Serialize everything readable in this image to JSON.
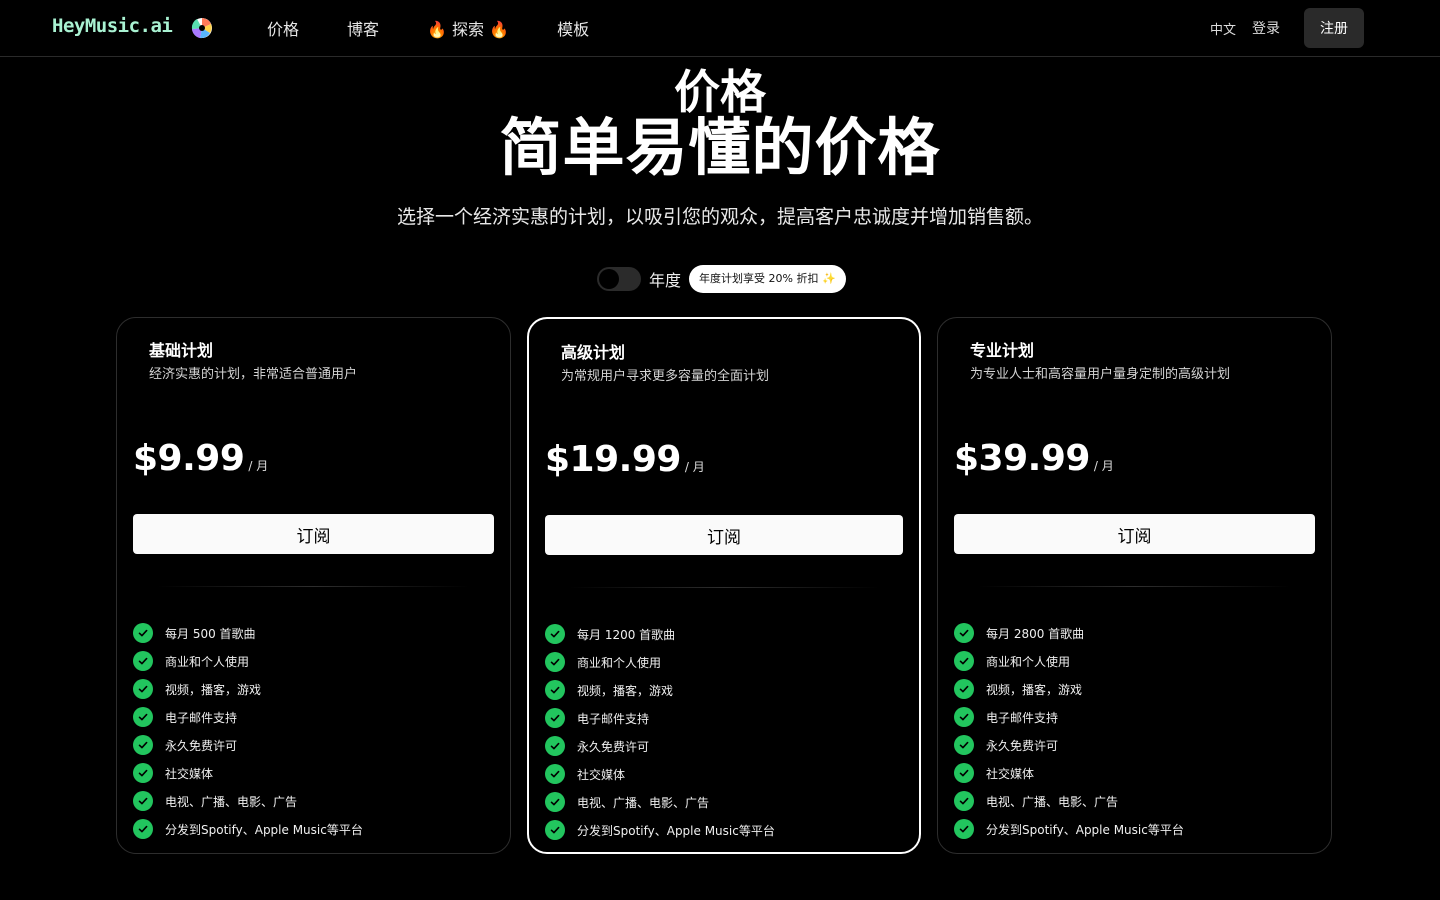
{
  "nav": {
    "logo": "HeyMusic.ai",
    "links": [
      "价格",
      "博客",
      "🔥 探索 🔥",
      "模板"
    ],
    "language": "中文",
    "login": "登录",
    "signup": "注册"
  },
  "hero": {
    "eyebrow": "价格",
    "headline": "简单易懂的价格",
    "subtitle": "选择一个经济实惠的计划，以吸引您的观众，提高客户忠诚度并增加销售额。"
  },
  "billing": {
    "toggle_on": false,
    "label": "年度",
    "discount_badge": "年度计划享受 20% 折扣 ✨"
  },
  "plans": [
    {
      "name": "基础计划",
      "description": "经济实惠的计划，非常适合普通用户",
      "price": "$9.99",
      "unit": "/ 月",
      "cta": "订阅",
      "features": [
        "每月 500 首歌曲",
        "商业和个人使用",
        "视频，播客，游戏",
        "电子邮件支持",
        "永久免费许可",
        "社交媒体",
        "电视、广播、电影、广告",
        "分发到Spotify、Apple Music等平台"
      ]
    },
    {
      "name": "高级计划",
      "description": "为常规用户寻求更多容量的全面计划",
      "price": "$19.99",
      "unit": "/ 月",
      "cta": "订阅",
      "features": [
        "每月 1200 首歌曲",
        "商业和个人使用",
        "视频，播客，游戏",
        "电子邮件支持",
        "永久免费许可",
        "社交媒体",
        "电视、广播、电影、广告",
        "分发到Spotify、Apple Music等平台"
      ]
    },
    {
      "name": "专业计划",
      "description": "为专业人士和高容量用户量身定制的高级计划",
      "price": "$39.99",
      "unit": "/ 月",
      "cta": "订阅",
      "features": [
        "每月 2800 首歌曲",
        "商业和个人使用",
        "视频，播客，游戏",
        "电子邮件支持",
        "永久免费许可",
        "社交媒体",
        "电视、广播、电影、广告",
        "分发到Spotify、Apple Music等平台"
      ]
    }
  ],
  "colors": {
    "background": "#000000",
    "check": "#22c55e",
    "logo": "#a9f2d2"
  }
}
